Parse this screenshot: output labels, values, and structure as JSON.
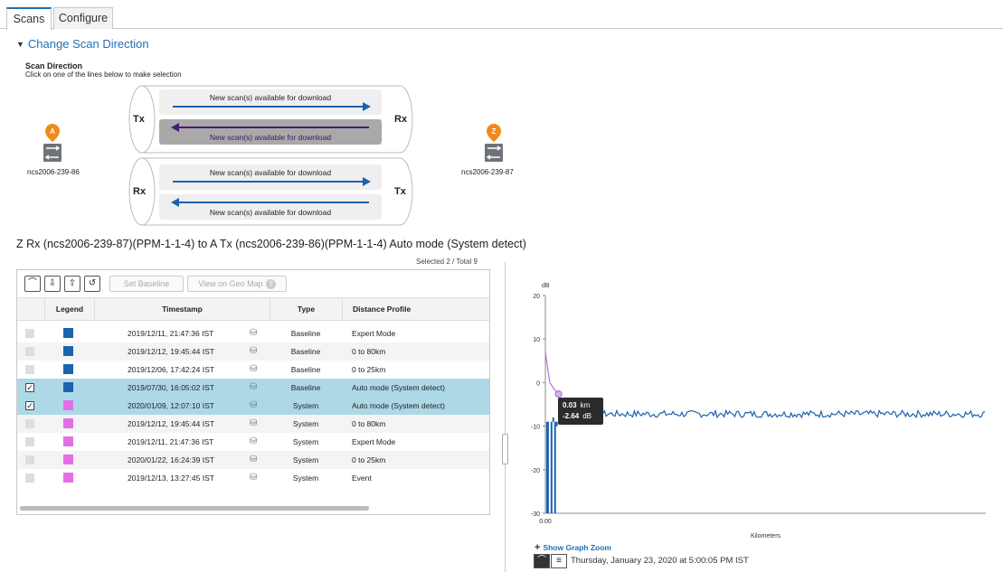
{
  "tabs": [
    {
      "label": "Scans"
    },
    {
      "label": "Configure"
    }
  ],
  "section_title": "Change Scan Direction",
  "scan_direction": {
    "title": "Scan Direction",
    "subtitle": "Click on one of the lines below to make selection",
    "node_a": {
      "badge": "A",
      "name": "ncs2006-239-86"
    },
    "node_z": {
      "badge": "Z",
      "name": "ncs2006-239-87"
    },
    "fibers": [
      {
        "left_end": "Tx",
        "right_end": "Rx",
        "lanes": [
          {
            "text": "New scan(s) available for download",
            "direction": "right",
            "selected": false
          },
          {
            "text": "New scan(s) available for download",
            "direction": "left",
            "selected": true
          }
        ]
      },
      {
        "left_end": "Rx",
        "right_end": "Tx",
        "lanes": [
          {
            "text": "New scan(s) available for download",
            "direction": "right",
            "selected": false
          },
          {
            "text": "New scan(s) available for download",
            "direction": "left",
            "selected": false
          }
        ]
      }
    ]
  },
  "route_title": "Z Rx (ncs2006-239-87)(PPM-1-1-4) to A Tx (ncs2006-239-86)(PPM-1-1-4)  Auto mode (System detect)",
  "selection_count": "Selected 2 / Total 9",
  "toolbar": {
    "set_baseline": "Set Baseline",
    "view_geo_map": "View on Geo Map"
  },
  "table": {
    "columns": [
      "Legend",
      "Timestamp",
      "Type",
      "Distance Profile"
    ],
    "rows": [
      {
        "checked": false,
        "color": "#1a63b0",
        "timestamp": "2019/12/11, 21:47:36 IST",
        "type": "Baseline",
        "profile": "Expert Mode"
      },
      {
        "checked": false,
        "color": "#1a63b0",
        "timestamp": "2019/12/12, 19:45:44 IST",
        "type": "Baseline",
        "profile": "0 to 80km"
      },
      {
        "checked": false,
        "color": "#1a63b0",
        "timestamp": "2019/12/06, 17:42:24 IST",
        "type": "Baseline",
        "profile": "0 to 25km"
      },
      {
        "checked": true,
        "color": "#1a63b0",
        "timestamp": "2019/07/30, 16:05:02 IST",
        "type": "Baseline",
        "profile": "Auto mode (System detect)"
      },
      {
        "checked": true,
        "color": "#e36fe6",
        "timestamp": "2020/01/09, 12:07:10 IST",
        "type": "System",
        "profile": "Auto mode (System detect)"
      },
      {
        "checked": false,
        "color": "#e36fe6",
        "timestamp": "2019/12/12, 19:45:44 IST",
        "type": "System",
        "profile": "0 to 80km"
      },
      {
        "checked": false,
        "color": "#e36fe6",
        "timestamp": "2019/12/11, 21:47:36 IST",
        "type": "System",
        "profile": "Expert Mode"
      },
      {
        "checked": false,
        "color": "#e36fe6",
        "timestamp": "2020/01/22, 16:24:39 IST",
        "type": "System",
        "profile": "0 to 25km"
      },
      {
        "checked": false,
        "color": "#e36fe6",
        "timestamp": "2019/12/13, 13:27:45 IST",
        "type": "System",
        "profile": "Event"
      }
    ]
  },
  "chart_data": {
    "type": "line",
    "ylabel": "dB",
    "xlabel": "Kilometers",
    "ylim": [
      -30,
      20
    ],
    "yticks": [
      20,
      10,
      0,
      -10,
      -20,
      -30
    ],
    "xticks": [
      "0.00"
    ],
    "tooltip": {
      "x": "0.03",
      "x_unit": "km",
      "y": "-2.64",
      "y_unit": "dB"
    },
    "series": [
      {
        "color": "#1a63b0",
        "description_points": [
          [
            0,
            10
          ],
          [
            0.005,
            8
          ],
          [
            0.01,
            -30
          ],
          [
            0.015,
            -9
          ],
          [
            0.02,
            -30
          ],
          [
            0.03,
            -7
          ],
          [
            0.1,
            -7.2
          ],
          [
            1.0,
            -7
          ]
        ]
      },
      {
        "color": "#b36fd6",
        "description_points": [
          [
            0,
            7
          ],
          [
            0.01,
            0
          ],
          [
            0.02,
            -1.5
          ],
          [
            0.03,
            -2.64
          ]
        ]
      }
    ]
  },
  "graph_zoom_label": "Show Graph Zoom",
  "footer_timestamp": "Thursday, January 23, 2020 at 5:00:05 PM IST",
  "colors": {
    "accent": "#1f6fb4",
    "baseline": "#1a63b0",
    "system": "#e36fe6",
    "selected_row": "#add8e6",
    "badge": "#f08a1c"
  }
}
